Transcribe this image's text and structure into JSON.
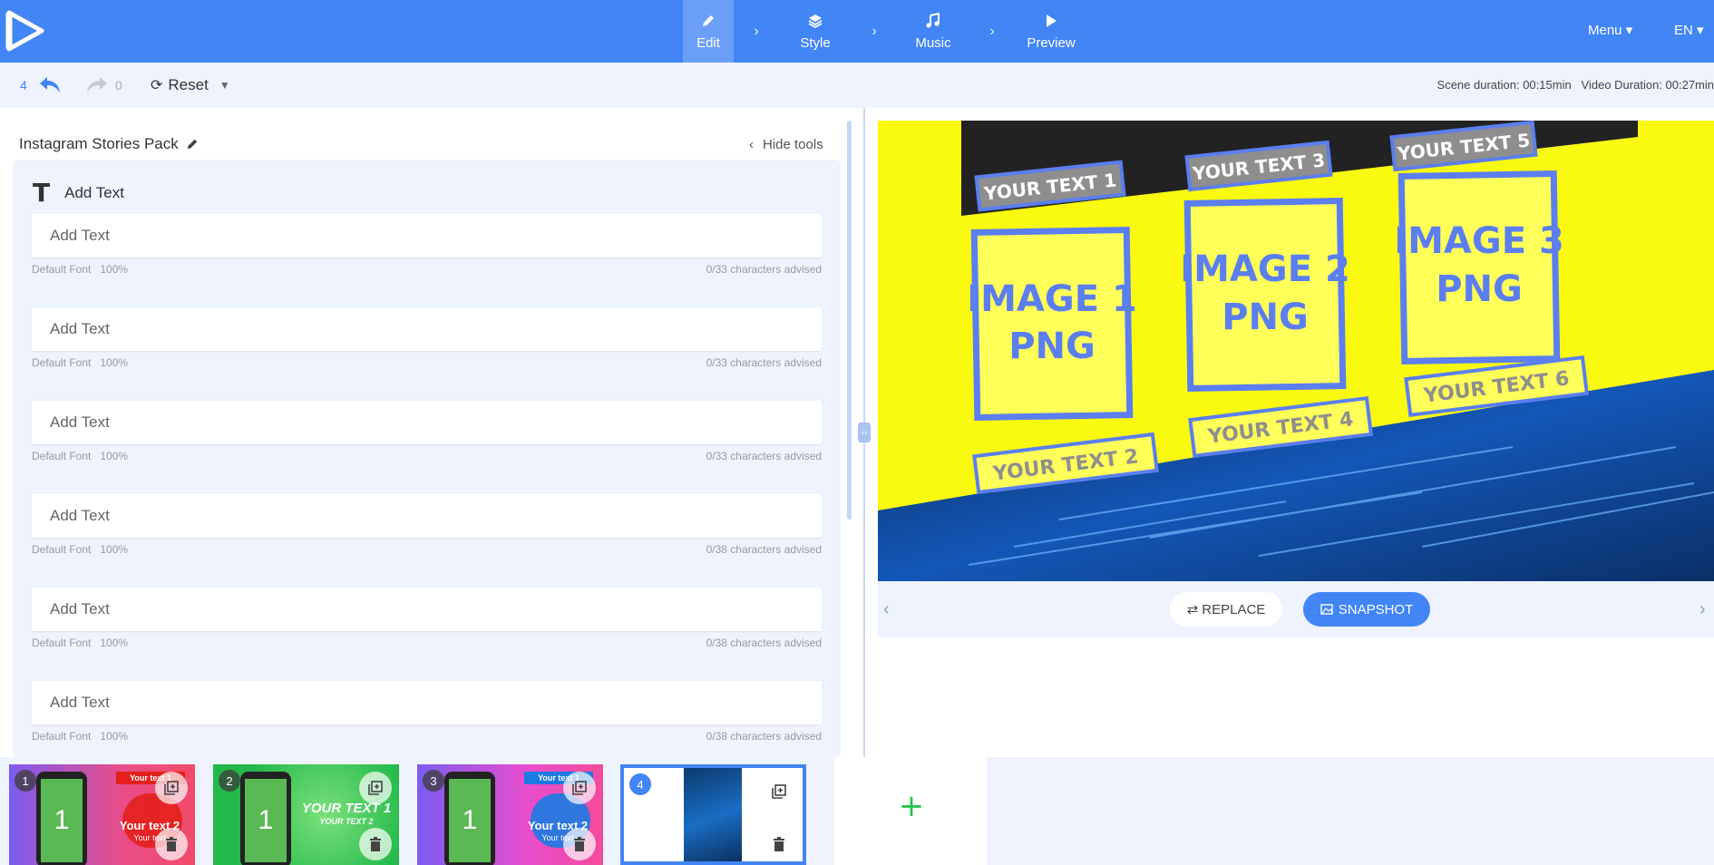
{
  "nav": {
    "steps": [
      {
        "label": "Edit",
        "icon": "pencil-icon"
      },
      {
        "label": "Style",
        "icon": "layers-icon"
      },
      {
        "label": "Music",
        "icon": "music-note-icon"
      },
      {
        "label": "Preview",
        "icon": "play-icon"
      }
    ],
    "menu_label": "Menu",
    "lang_label": "EN"
  },
  "toolbar": {
    "undo_count": "4",
    "redo_count": "0",
    "reset_label": "Reset",
    "scene_duration": "Scene duration: 00:15min",
    "video_duration": "Video Duration: 00:27min"
  },
  "panel": {
    "project_title": "Instagram Stories Pack",
    "hide_tools_label": "Hide tools",
    "section_title": "Add Text",
    "fields": [
      {
        "placeholder": "Add Text",
        "font": "Default Font",
        "size": "100%",
        "hint": "0/33 characters advised"
      },
      {
        "placeholder": "Add Text",
        "font": "Default Font",
        "size": "100%",
        "hint": "0/33 characters advised"
      },
      {
        "placeholder": "Add Text",
        "font": "Default Font",
        "size": "100%",
        "hint": "0/33 characters advised"
      },
      {
        "placeholder": "Add Text",
        "font": "Default Font",
        "size": "100%",
        "hint": "0/38 characters advised"
      },
      {
        "placeholder": "Add Text",
        "font": "Default Font",
        "size": "100%",
        "hint": "0/38 characters advised"
      },
      {
        "placeholder": "Add Text",
        "font": "Default Font",
        "size": "100%",
        "hint": "0/38 characters advised"
      }
    ]
  },
  "preview": {
    "texts": [
      "YOUR TEXT 1",
      "YOUR TEXT 2",
      "YOUR TEXT 3",
      "YOUR TEXT 4",
      "YOUR TEXT 5",
      "YOUR TEXT 6"
    ],
    "images": [
      {
        "line1": "IMAGE 1",
        "line2": "PNG"
      },
      {
        "line1": "IMAGE 2",
        "line2": "PNG"
      },
      {
        "line1": "IMAGE 3",
        "line2": "PNG"
      }
    ],
    "replace_label": "REPLACE",
    "snapshot_label": "SNAPSHOT",
    "colors": {
      "background": "#fafa10",
      "frame": "#5b7ef0",
      "label_bg": "#8e8e8e",
      "label_text": "#ffffff"
    }
  },
  "scenes": [
    {
      "number": "1",
      "big": "1",
      "caption": "Your text 2",
      "small": "Your text",
      "tag": "Your text 1"
    },
    {
      "number": "2",
      "big": "1",
      "caption": "YOUR TEXT 1",
      "small": "YOUR TEXT 2"
    },
    {
      "number": "3",
      "big": "1",
      "caption": "Your text 2",
      "small": "Your text",
      "tag": "Your text 1"
    },
    {
      "number": "4"
    }
  ],
  "theme": {
    "accent": "#4285f4",
    "panel_bg": "#eef3fd",
    "add_color": "#27c24c"
  }
}
